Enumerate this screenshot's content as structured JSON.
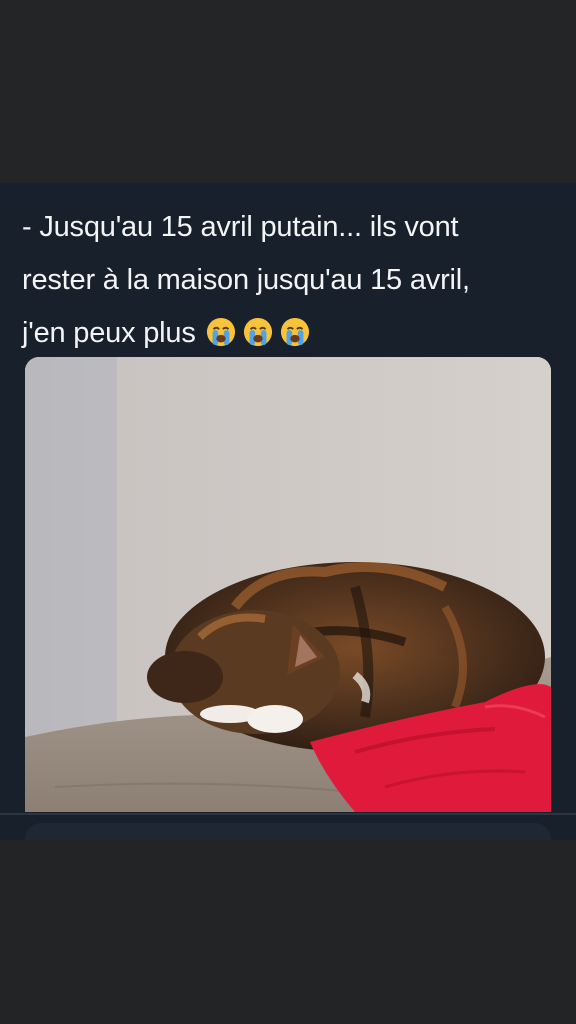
{
  "tweet": {
    "lines": [
      "- Jusqu'au 15 avril putain... ils vont",
      "rester à la maison jusqu'au 15 avril,",
      "j'en peux plus"
    ],
    "emojis": [
      "crying-face",
      "crying-face",
      "crying-face"
    ]
  },
  "media": {
    "subject": "cat-hiding-face-photo"
  },
  "colors": {
    "page_background": "#222324",
    "tweet_background": "#18202b",
    "text": "#f2f4f6",
    "emoji_face": "#f6c33b",
    "emoji_tears": "#4fa3e6"
  }
}
